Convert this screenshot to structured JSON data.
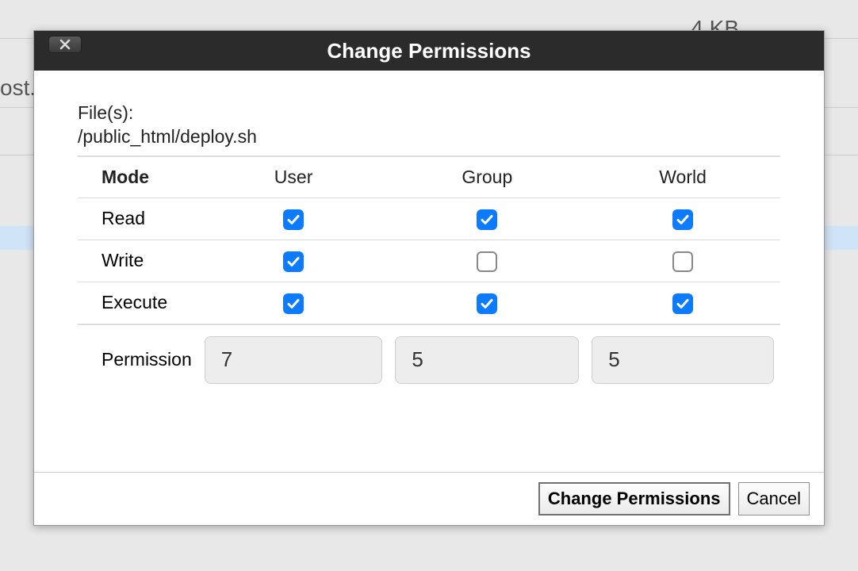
{
  "background": {
    "filesize": "4 KB",
    "left_fragment": "ost."
  },
  "dialog": {
    "title": "Change Permissions",
    "files_label": "File(s):",
    "file_path": "/public_html/deploy.sh",
    "table": {
      "header_mode": "Mode",
      "header_user": "User",
      "header_group": "Group",
      "header_world": "World",
      "row_read": "Read",
      "row_write": "Write",
      "row_execute": "Execute",
      "row_permission": "Permission"
    },
    "checkboxes": {
      "user_read": true,
      "user_write": true,
      "user_execute": true,
      "group_read": true,
      "group_write": false,
      "group_execute": true,
      "world_read": true,
      "world_write": false,
      "world_execute": true
    },
    "permission": {
      "user": "7",
      "group": "5",
      "world": "5"
    },
    "buttons": {
      "confirm": "Change Permissions",
      "cancel": "Cancel"
    }
  }
}
